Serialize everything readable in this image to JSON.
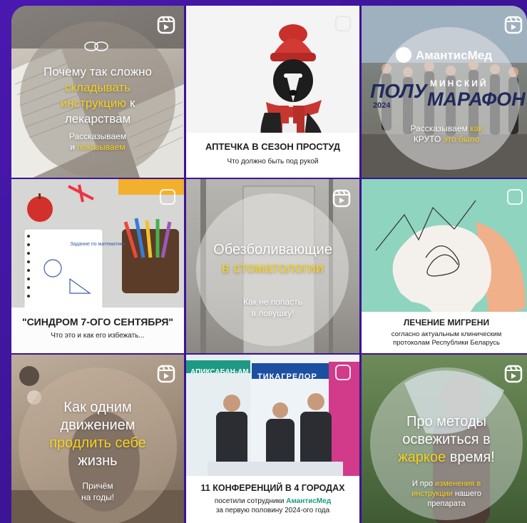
{
  "grid": {
    "tiles": [
      {
        "lines": [
          "Почему так сложно",
          "складывать",
          "инструкцию",
          "к",
          "лекарствам"
        ],
        "sub": [
          "Рассказываем",
          "и",
          "показываем"
        ]
      },
      {
        "title": "АПТЕЧКА В СЕЗОН ПРОСТУД",
        "subtitle": "Что должно быть под рукой"
      },
      {
        "brand": "АмантисМед",
        "event_left": "ПОЛУ",
        "event_minsk": "МИНСКИЙ",
        "event_right": "МАРАФОН",
        "year": "2024",
        "sub1a": "Рассказываем",
        "sub1b": "как",
        "sub2a": "КРУТО",
        "sub2b": "это было"
      },
      {
        "notebook": "Задание по математике",
        "title": "\"СИНДРОМ 7-ОГО СЕНТЯБРЯ\"",
        "subtitle": "Что это и как его избежать..."
      },
      {
        "line1": "Обезболивающие",
        "line2": "в стоматологии",
        "sub1": "Как не попасть",
        "sub2": "в ловушку!"
      },
      {
        "title": "ЛЕЧЕНИЕ МИГРЕНИ",
        "sub1": "согласно актуальным клиническим",
        "sub2": "протоколам Республики Беларусь"
      },
      {
        "line1": "Как одним",
        "line2": "движением",
        "line3": "продлить себе",
        "line4": "жизнь",
        "sub1": "Причём",
        "sub2": "на годы!"
      },
      {
        "banner_left": "АПИКСАБАН-АМ",
        "banner_right": "ТИКАГРЕЛОР",
        "title": "11 КОНФЕРЕНЦИЙ В 4 ГОРОДАХ",
        "sub1a": "посетили сотрудники",
        "sub1b": "АмантисМед",
        "sub2": "за первую половину 2024-ого года"
      },
      {
        "line1": "Про методы",
        "line2": "освежиться в",
        "line3a": "жаркое",
        "line3b": "время!",
        "sub1a": "И про",
        "sub1b": "изменения в",
        "sub2a": "инструкции",
        "sub2b": "нашего",
        "sub3": "препарата"
      }
    ]
  },
  "colors": {
    "frame": "#3b1494",
    "accent_yellow": "#f7d21e"
  }
}
